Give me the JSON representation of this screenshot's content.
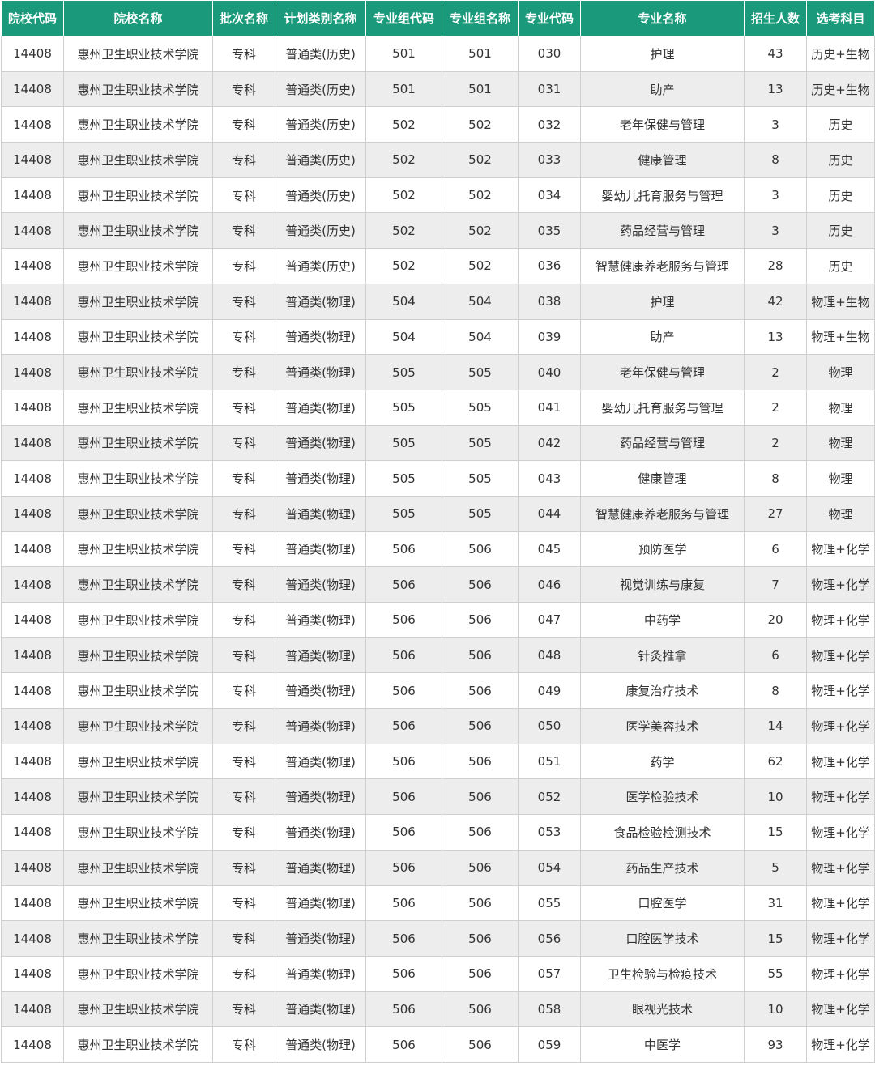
{
  "table": {
    "headers": [
      "院校代码",
      "院校名称",
      "批次名称",
      "计划类别名称",
      "专业组代码",
      "专业组名称",
      "专业代码",
      "专业名称",
      "招生人数",
      "选考科目"
    ],
    "rows": [
      [
        "14408",
        "惠州卫生职业技术学院",
        "专科",
        "普通类(历史)",
        "501",
        "501",
        "030",
        "护理",
        "43",
        "历史+生物"
      ],
      [
        "14408",
        "惠州卫生职业技术学院",
        "专科",
        "普通类(历史)",
        "501",
        "501",
        "031",
        "助产",
        "13",
        "历史+生物"
      ],
      [
        "14408",
        "惠州卫生职业技术学院",
        "专科",
        "普通类(历史)",
        "502",
        "502",
        "032",
        "老年保健与管理",
        "3",
        "历史"
      ],
      [
        "14408",
        "惠州卫生职业技术学院",
        "专科",
        "普通类(历史)",
        "502",
        "502",
        "033",
        "健康管理",
        "8",
        "历史"
      ],
      [
        "14408",
        "惠州卫生职业技术学院",
        "专科",
        "普通类(历史)",
        "502",
        "502",
        "034",
        "婴幼儿托育服务与管理",
        "3",
        "历史"
      ],
      [
        "14408",
        "惠州卫生职业技术学院",
        "专科",
        "普通类(历史)",
        "502",
        "502",
        "035",
        "药品经营与管理",
        "3",
        "历史"
      ],
      [
        "14408",
        "惠州卫生职业技术学院",
        "专科",
        "普通类(历史)",
        "502",
        "502",
        "036",
        "智慧健康养老服务与管理",
        "28",
        "历史"
      ],
      [
        "14408",
        "惠州卫生职业技术学院",
        "专科",
        "普通类(物理)",
        "504",
        "504",
        "038",
        "护理",
        "42",
        "物理+生物"
      ],
      [
        "14408",
        "惠州卫生职业技术学院",
        "专科",
        "普通类(物理)",
        "504",
        "504",
        "039",
        "助产",
        "13",
        "物理+生物"
      ],
      [
        "14408",
        "惠州卫生职业技术学院",
        "专科",
        "普通类(物理)",
        "505",
        "505",
        "040",
        "老年保健与管理",
        "2",
        "物理"
      ],
      [
        "14408",
        "惠州卫生职业技术学院",
        "专科",
        "普通类(物理)",
        "505",
        "505",
        "041",
        "婴幼儿托育服务与管理",
        "2",
        "物理"
      ],
      [
        "14408",
        "惠州卫生职业技术学院",
        "专科",
        "普通类(物理)",
        "505",
        "505",
        "042",
        "药品经营与管理",
        "2",
        "物理"
      ],
      [
        "14408",
        "惠州卫生职业技术学院",
        "专科",
        "普通类(物理)",
        "505",
        "505",
        "043",
        "健康管理",
        "8",
        "物理"
      ],
      [
        "14408",
        "惠州卫生职业技术学院",
        "专科",
        "普通类(物理)",
        "505",
        "505",
        "044",
        "智慧健康养老服务与管理",
        "27",
        "物理"
      ],
      [
        "14408",
        "惠州卫生职业技术学院",
        "专科",
        "普通类(物理)",
        "506",
        "506",
        "045",
        "预防医学",
        "6",
        "物理+化学"
      ],
      [
        "14408",
        "惠州卫生职业技术学院",
        "专科",
        "普通类(物理)",
        "506",
        "506",
        "046",
        "视觉训练与康复",
        "7",
        "物理+化学"
      ],
      [
        "14408",
        "惠州卫生职业技术学院",
        "专科",
        "普通类(物理)",
        "506",
        "506",
        "047",
        "中药学",
        "20",
        "物理+化学"
      ],
      [
        "14408",
        "惠州卫生职业技术学院",
        "专科",
        "普通类(物理)",
        "506",
        "506",
        "048",
        "针灸推拿",
        "6",
        "物理+化学"
      ],
      [
        "14408",
        "惠州卫生职业技术学院",
        "专科",
        "普通类(物理)",
        "506",
        "506",
        "049",
        "康复治疗技术",
        "8",
        "物理+化学"
      ],
      [
        "14408",
        "惠州卫生职业技术学院",
        "专科",
        "普通类(物理)",
        "506",
        "506",
        "050",
        "医学美容技术",
        "14",
        "物理+化学"
      ],
      [
        "14408",
        "惠州卫生职业技术学院",
        "专科",
        "普通类(物理)",
        "506",
        "506",
        "051",
        "药学",
        "62",
        "物理+化学"
      ],
      [
        "14408",
        "惠州卫生职业技术学院",
        "专科",
        "普通类(物理)",
        "506",
        "506",
        "052",
        "医学检验技术",
        "10",
        "物理+化学"
      ],
      [
        "14408",
        "惠州卫生职业技术学院",
        "专科",
        "普通类(物理)",
        "506",
        "506",
        "053",
        "食品检验检测技术",
        "15",
        "物理+化学"
      ],
      [
        "14408",
        "惠州卫生职业技术学院",
        "专科",
        "普通类(物理)",
        "506",
        "506",
        "054",
        "药品生产技术",
        "5",
        "物理+化学"
      ],
      [
        "14408",
        "惠州卫生职业技术学院",
        "专科",
        "普通类(物理)",
        "506",
        "506",
        "055",
        "口腔医学",
        "31",
        "物理+化学"
      ],
      [
        "14408",
        "惠州卫生职业技术学院",
        "专科",
        "普通类(物理)",
        "506",
        "506",
        "056",
        "口腔医学技术",
        "15",
        "物理+化学"
      ],
      [
        "14408",
        "惠州卫生职业技术学院",
        "专科",
        "普通类(物理)",
        "506",
        "506",
        "057",
        "卫生检验与检疫技术",
        "55",
        "物理+化学"
      ],
      [
        "14408",
        "惠州卫生职业技术学院",
        "专科",
        "普通类(物理)",
        "506",
        "506",
        "058",
        "眼视光技术",
        "10",
        "物理+化学"
      ],
      [
        "14408",
        "惠州卫生职业技术学院",
        "专科",
        "普通类(物理)",
        "506",
        "506",
        "059",
        "中医学",
        "93",
        "物理+化学"
      ]
    ]
  },
  "colors": {
    "header_bg": "#1a9a7b",
    "header_text": "#ffffff",
    "stripe_bg": "#ededed",
    "border": "#cfcfcf"
  }
}
